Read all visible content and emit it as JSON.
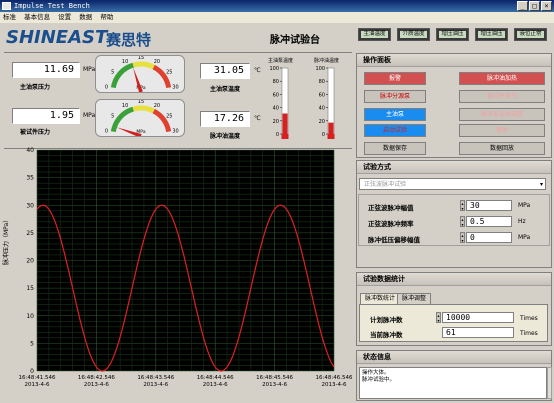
{
  "window": {
    "title": "Impulse Test Bench"
  },
  "menu": [
    "标准",
    "基本信息",
    "设置",
    "数据",
    "帮助"
  ],
  "header": {
    "brand": "SHINEAST",
    "brand_cn": "赛思特",
    "title": "脉冲试验台"
  },
  "indicators": [
    "主油温度",
    "介质温度",
    "增压油压",
    "增压油压",
    "液位正常"
  ],
  "readouts": {
    "main_pressure": {
      "value": "11.69",
      "unit": "MPa",
      "label": "主油泵压力"
    },
    "test_pressure": {
      "value": "1.95",
      "unit": "MPa",
      "label": "被试件压力"
    },
    "main_temp": {
      "value": "31.05",
      "unit": "℃",
      "label": "主油泵温度"
    },
    "pulse_temp": {
      "value": "17.26",
      "unit": "℃",
      "label": "脉冲油温度"
    }
  },
  "gauges": {
    "top": {
      "ticks": [
        "0",
        "5",
        "10",
        "15",
        "20",
        "25",
        "30"
      ],
      "unit": "MPa",
      "value": 11.69
    },
    "bottom": {
      "ticks": [
        "0",
        "5",
        "10",
        "15",
        "20",
        "25",
        "30"
      ],
      "unit": "MPa",
      "value": 1.95
    }
  },
  "thermometers": {
    "main": {
      "title": "主油泵温度",
      "ticks": [
        "100",
        "80",
        "60",
        "40",
        "20",
        "0"
      ],
      "value": 31.05
    },
    "pulse": {
      "title": "脉冲油温度",
      "ticks": [
        "100",
        "80",
        "60",
        "40",
        "20",
        "0"
      ],
      "value": 17.26
    }
  },
  "control_panel": {
    "title": "操作面板",
    "buttons": [
      {
        "label": "报警",
        "style": "red"
      },
      {
        "label": "脉冲油加热",
        "style": "red"
      },
      {
        "label": "脉冲分源泵",
        "style": "red-text"
      },
      {
        "label": "被试件排气",
        "style": "disabled"
      },
      {
        "label": "主油泵",
        "style": "blue"
      },
      {
        "label": "脉冲安全阀调整",
        "style": "disabled"
      },
      {
        "label": "启动试验",
        "style": "blue-text"
      },
      {
        "label": "暂停",
        "style": "disabled"
      },
      {
        "label": "数据保存",
        "style": "plain"
      },
      {
        "label": "数据回放",
        "style": "plain"
      }
    ]
  },
  "test_mode": {
    "title": "试验方式",
    "selected": "正弦波脉冲试验",
    "fields": [
      {
        "label": "正弦波脉冲幅值",
        "value": "30",
        "unit": "MPa"
      },
      {
        "label": "正弦波脉冲频率",
        "value": "0.5",
        "unit": "Hz"
      },
      {
        "label": "脉冲低压偏移幅值",
        "value": "0",
        "unit": "MPa"
      }
    ]
  },
  "stats": {
    "title": "试验数据统计",
    "tabs": [
      "脉冲数统计",
      "脉冲调整"
    ],
    "fields": [
      {
        "label": "计划脉冲数",
        "value": "10000",
        "unit": "Times"
      },
      {
        "label": "当前脉冲数",
        "value": "61",
        "unit": "Times"
      }
    ]
  },
  "status": {
    "title": "状态信息",
    "lines": [
      "操作大体。",
      "脉冲试验中。"
    ]
  },
  "chart_data": {
    "type": "line",
    "ylabel": "脉冲压力（MPa）",
    "ylim": [
      0,
      40
    ],
    "yticks": [
      "40",
      "35",
      "30",
      "25",
      "20",
      "15",
      "10",
      "5",
      "0"
    ],
    "xticks": [
      [
        "16:48:41.546",
        "2013-4-6"
      ],
      [
        "16:48:42.546",
        "2013-4-6"
      ],
      [
        "16:48:43.546",
        "2013-4-6"
      ],
      [
        "16:48:44.546",
        "2013-4-6"
      ],
      [
        "16:48:45.546",
        "2013-4-6"
      ],
      [
        "16:48:46.546",
        "2013-4-6"
      ]
    ],
    "series": [
      {
        "color": "#e02020",
        "period_s": 2.0,
        "amplitude": 15,
        "offset": 15,
        "phase_peak_s": 0.1
      }
    ],
    "grid": true
  }
}
